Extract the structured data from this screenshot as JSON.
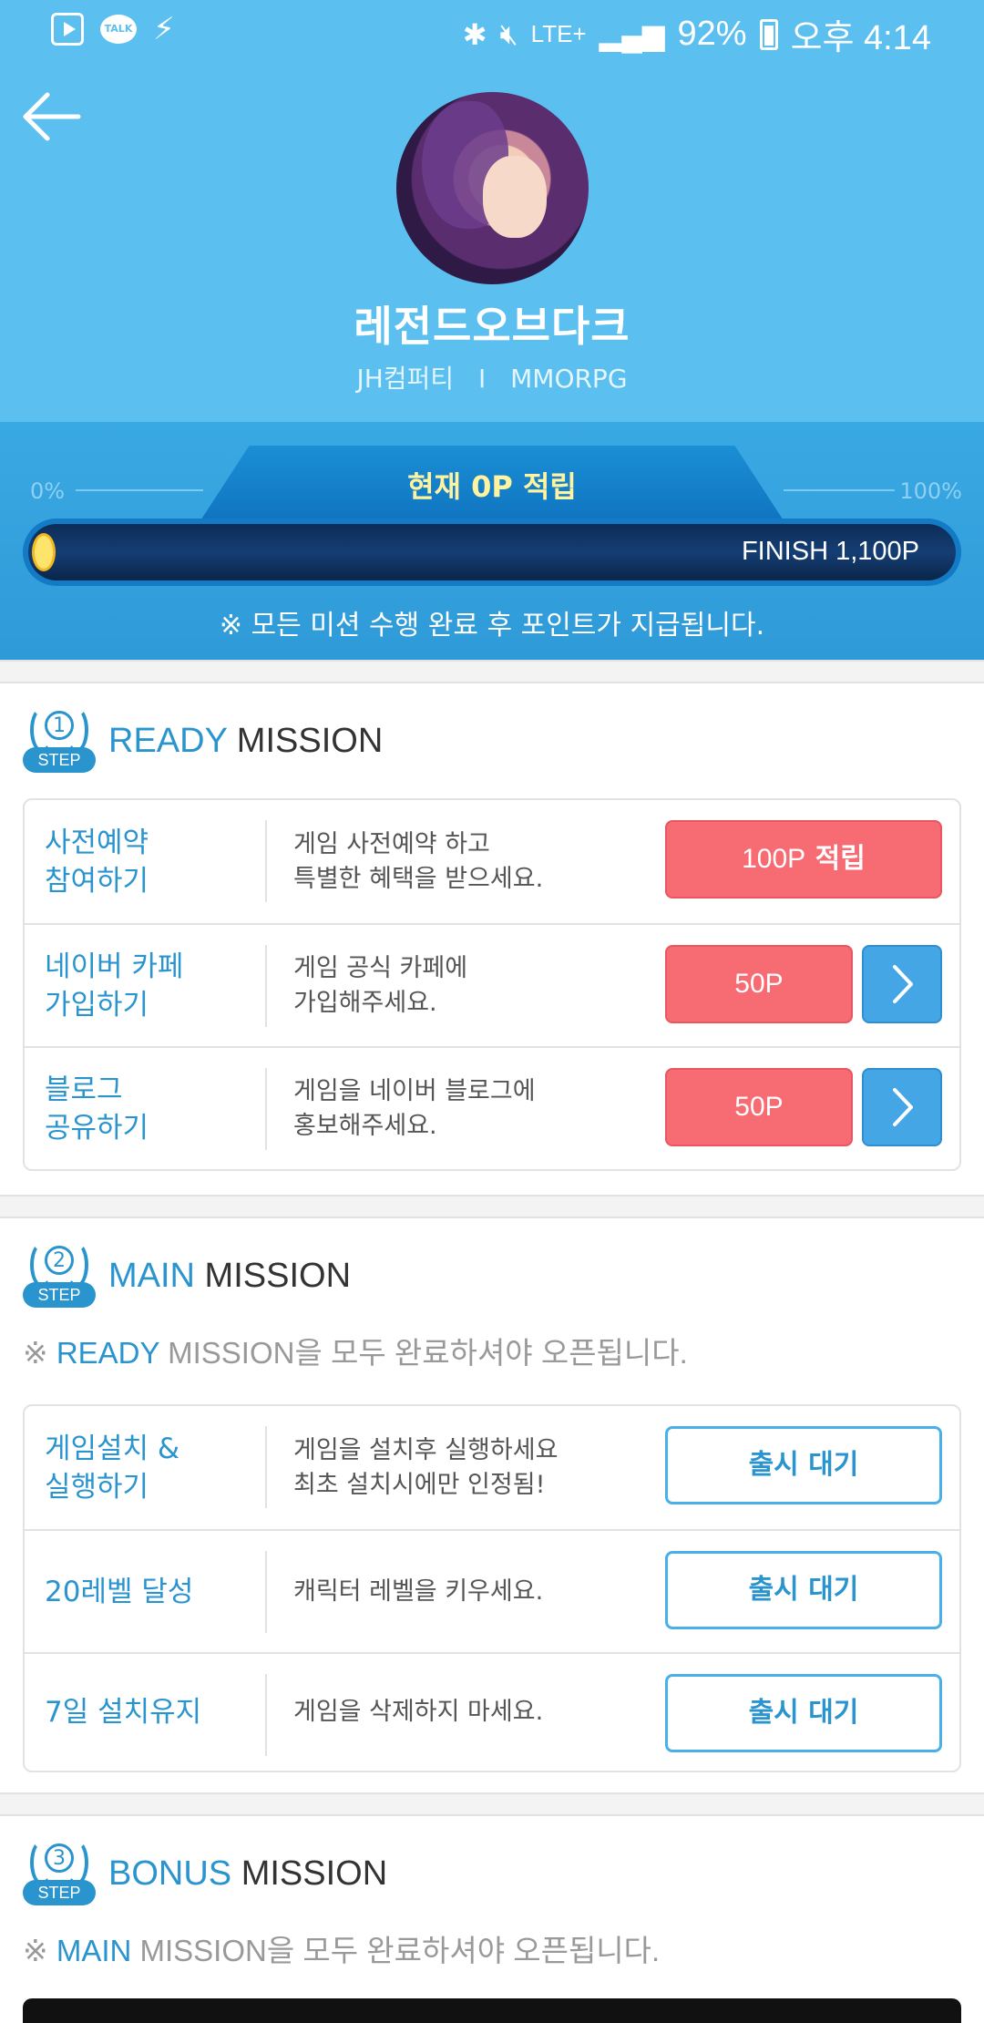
{
  "status_bar": {
    "battery": "92%",
    "time": "오후 4:14",
    "network": "LTE+",
    "talk_icon_text": "TALK"
  },
  "game": {
    "title": "레전드오브다크",
    "developer": "JH컴퍼티",
    "separator": "I",
    "genre": "MMORPG"
  },
  "progress": {
    "current_label": "현재 0P 적립",
    "min_label": "0%",
    "max_label": "100%",
    "finish_label": "FINISH 1,100P",
    "fill_fraction": 0.0,
    "note": "※ 모든 미션 수행 완료 후 포인트가 지급됩니다."
  },
  "steps": [
    {
      "num": "1",
      "tag": "STEP",
      "highlight": "READY",
      "rest": " MISSION",
      "missions": [
        {
          "title": "사전예약\n참여하기",
          "desc": "게임 사전예약 하고\n특별한 혜택을 받으세요.",
          "points": "100P",
          "points_suffix": " 적립"
        },
        {
          "title": "네이버 카페\n가입하기",
          "desc": "게임 공식 카페에\n가입해주세요.",
          "points": "50P"
        },
        {
          "title": "블로그\n공유하기",
          "desc": "게임을 네이버 블로그에\n홍보해주세요.",
          "points": "50P"
        }
      ]
    },
    {
      "num": "2",
      "tag": "STEP",
      "highlight": "MAIN",
      "rest": " MISSION",
      "note_prefix": "※ ",
      "note_highlight": "READY",
      "note_rest": " MISSION을 모두 완료하셔야 오픈됩니다.",
      "missions": [
        {
          "title": "게임설치 &\n실행하기",
          "desc": "게임을 설치후 실행하세요\n최초 설치시에만 인정됨!",
          "button": "출시 대기"
        },
        {
          "title": "20레벨 달성",
          "desc": "캐릭터 레벨을 키우세요.",
          "button": "출시 대기"
        },
        {
          "title": "7일 설치유지",
          "desc": "게임을 삭제하지 마세요.",
          "button": "출시 대기"
        }
      ]
    },
    {
      "num": "3",
      "tag": "STEP",
      "highlight": "BONUS",
      "rest": " MISSION",
      "note_prefix": "※ ",
      "note_highlight": "MAIN",
      "note_rest": " MISSION을 모두 완료하셔야 오픈됩니다."
    }
  ],
  "colors": {
    "header_bg": "#5bbff0",
    "accent_blue": "#2a94cf",
    "points_red": "#f76b73",
    "progress_label": "#fff3a0"
  },
  "icons": [
    "play-store-icon",
    "kakao-talk-icon",
    "flash-icon",
    "bluetooth-icon",
    "mute-icon",
    "signal-icon",
    "battery-icon",
    "back-arrow-icon",
    "chevron-right-icon",
    "laurel-step-icon"
  ]
}
